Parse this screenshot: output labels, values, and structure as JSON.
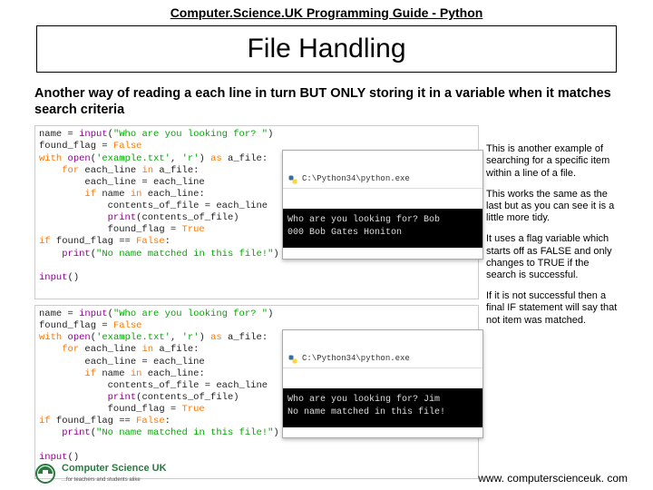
{
  "header": "Computer.Science.UK Programming Guide - Python",
  "title": "File Handling",
  "subtitle": "Another way of reading a each line in turn BUT ONLY storing it in a variable when it matches search criteria",
  "code1": {
    "l1a": "name = ",
    "l1b": "input",
    "l1c": "(",
    "l1d": "\"Who are you looking for? \"",
    "l1e": ")",
    "l2a": "found_flag = ",
    "l2b": "False",
    "l3a": "with",
    "l3b": " ",
    "l3c": "open",
    "l3d": "(",
    "l3e": "'example.txt'",
    "l3f": ", ",
    "l3g": "'r'",
    "l3h": ") ",
    "l3i": "as",
    "l3j": " a_file:",
    "l4a": "    ",
    "l4b": "for",
    "l4c": " each_line ",
    "l4d": "in",
    "l4e": " a_file:",
    "l5": "        each_line = each_line",
    "l6a": "        ",
    "l6b": "if",
    "l6c": " name ",
    "l6d": "in",
    "l6e": " each_line:",
    "l7": "            contents_of_file = each_line",
    "l8a": "            ",
    "l8b": "print",
    "l8c": "(contents_of_file)",
    "l9a": "            found_flag = ",
    "l9b": "True",
    "l10a": "if",
    "l10b": " found_flag == ",
    "l10c": "False",
    "l10d": ":",
    "l11a": "    ",
    "l11b": "print",
    "l11c": "(",
    "l11d": "\"No name matched in this file!\"",
    "l11e": ")",
    "blank": "",
    "l12a": "input",
    "l12b": "()"
  },
  "console1": {
    "path": "C:\\Python34\\python.exe",
    "text": "Who are you looking for? Bob\n000 Bob Gates Honiton"
  },
  "console2": {
    "path": "C:\\Python34\\python.exe",
    "text": "Who are you looking for? Jim\nNo name matched in this file!"
  },
  "notes": {
    "p1": "This is another example of searching for a specific item within a line of a file.",
    "p2": "This works the same as the last but as you can see it is a little more tidy.",
    "p3": "It uses a flag variable which starts off as FALSE and only changes to TRUE if the search is successful.",
    "p4": "If it is not successful then a final IF statement will say that not item was matched."
  },
  "footer": {
    "url": "www. computerscienceuk. com",
    "logo_main": "Computer Science UK",
    "logo_sub": "...for teachers and students alike"
  }
}
